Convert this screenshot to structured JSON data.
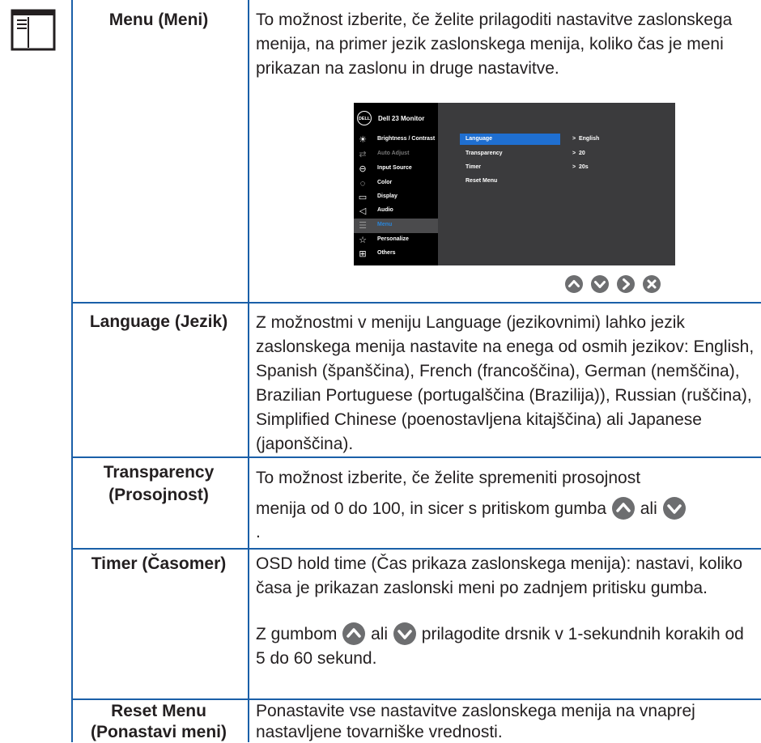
{
  "rows": [
    {
      "label": "Menu (Meni)",
      "desc": "To možnost izberite, če želite prilagoditi nastavitve zaslonskega menija, na primer jezik zaslonskega menija, koliko čas je meni prikazan na zaslonu in druge nastavitve."
    },
    {
      "label": "Language (Jezik)",
      "desc": "Z možnostmi v meniju Language (jezikovnimi) lahko jezik zaslonskega menija nastavite na enega od osmih jezikov: English, Spanish (španščina), French (francoščina), German (nemščina), Brazilian Portuguese (portugalščina (Brazilija)), Russian (ruščina), Simplified Chinese (poenostavljena kitajščina) ali Japanese (japonščina)."
    },
    {
      "label_l1": "Transparency",
      "label_l2": "(Prosojnost)",
      "desc_l1": "To možnost izberite, če želite spremeniti prosojnost",
      "desc_l2": "menija od 0 do 100, in sicer s pritiskom gumba",
      "desc_or": "ali",
      "desc_end": "."
    },
    {
      "label": "Timer (Časomer)",
      "desc_p1": "OSD hold time (Čas prikaza zaslonskega menija): nastavi, koliko časa je prikazan zaslonski meni po zadnjem pritisku gumba.",
      "desc_p2a": "Z gumbom",
      "desc_p2b": "ali",
      "desc_p2c": "prilagodite drsnik v 1-sekundnih korakih od 5 do 60 sekund."
    },
    {
      "label_l1": "Reset Menu",
      "label_l2": "(Ponastavi meni)",
      "desc": "Ponastavite vse nastavitve zaslonskega menija na vnaprej nastavljene tovarniške vrednosti."
    }
  ],
  "osd": {
    "logo": "DELL",
    "title": "Dell 23 Monitor",
    "menu": [
      {
        "label": "Brightness / Contrast",
        "icon": "sun-icon",
        "state": "normal"
      },
      {
        "label": "Auto Adjust",
        "icon": "auto-adjust-icon",
        "state": "dim"
      },
      {
        "label": "Input Source",
        "icon": "input-icon",
        "state": "normal"
      },
      {
        "label": "Color",
        "icon": "color-icon",
        "state": "normal"
      },
      {
        "label": "Display",
        "icon": "display-icon",
        "state": "normal"
      },
      {
        "label": "Audio",
        "icon": "audio-icon",
        "state": "normal"
      },
      {
        "label": "Menu",
        "icon": "menu-icon",
        "state": "active"
      },
      {
        "label": "Personalize",
        "icon": "star-icon",
        "state": "normal"
      },
      {
        "label": "Others",
        "icon": "others-icon",
        "state": "normal"
      }
    ],
    "settings": [
      {
        "label": "Language",
        "value": "English"
      },
      {
        "label": "Transparency",
        "value": "20"
      },
      {
        "label": "Timer",
        "value": "20s"
      },
      {
        "label": "Reset Menu",
        "value": ""
      }
    ]
  },
  "colors": {
    "rule": "#1a5fa8",
    "button": "#6d6e70",
    "selected": "#1f6fd1"
  }
}
